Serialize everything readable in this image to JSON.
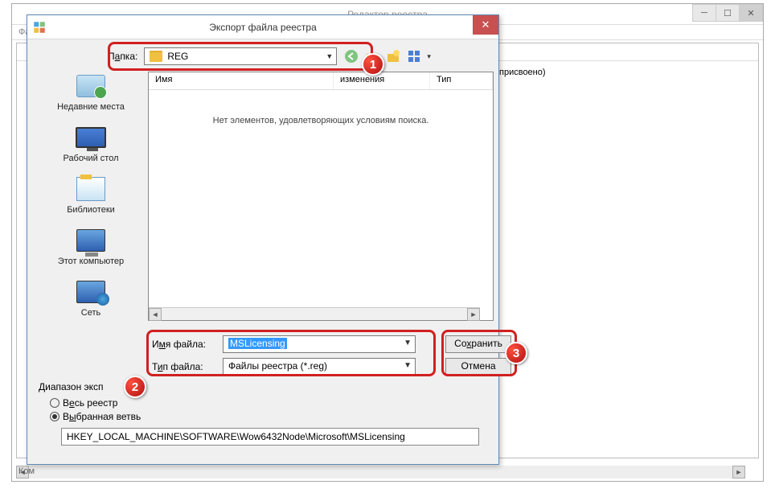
{
  "bg": {
    "title": "Редактор реестра",
    "menu_file": "Фа",
    "col_header": "",
    "value_text": "присвоено)",
    "status": "Ком",
    "controls": {
      "min": "─",
      "max": "☐",
      "close": "✕"
    }
  },
  "dlg": {
    "title": "Экспорт файла реестра",
    "close": "✕",
    "folder_label_pre": "П",
    "folder_label_und": "а",
    "folder_label_post": "пка:",
    "folder_value": "REG",
    "toolbar": {
      "back": "←",
      "up": "↑",
      "new": "✧",
      "view": "▦",
      "viewdrop": "▾"
    }
  },
  "places": {
    "recent": "Недавние места",
    "desktop": "Рабочий стол",
    "libraries": "Библиотеки",
    "pc": "Этот компьютер",
    "network": "Сеть"
  },
  "filelist": {
    "col_name": "Имя",
    "col_date": "изменения",
    "col_type": "Тип",
    "empty": "Нет элементов, удовлетворяющих условиям поиска.",
    "scroll_left": "◄",
    "scroll_right": "►"
  },
  "form": {
    "filename_label_pre": "И",
    "filename_label_und": "м",
    "filename_label_post": "я файла:",
    "filename_value": "MSLicensing",
    "filetype_label_pre": "Т",
    "filetype_label_und": "и",
    "filetype_label_post": "п файла:",
    "filetype_value": "Файлы реестра (*.reg)"
  },
  "buttons": {
    "save_pre": "Со",
    "save_und": "х",
    "save_post": "ранить",
    "cancel": "Отмена"
  },
  "range": {
    "title": "Диапазон эксп",
    "opt_all_pre": "В",
    "opt_all_und": "е",
    "opt_all_post": "сь реестр",
    "opt_sel_pre": "В",
    "opt_sel_und": "ы",
    "opt_sel_post": "бранная ветвь",
    "branch": "HKEY_LOCAL_MACHINE\\SOFTWARE\\Wow6432Node\\Microsoft\\MSLicensing"
  },
  "badges": {
    "b1": "1",
    "b2": "2",
    "b3": "3"
  }
}
